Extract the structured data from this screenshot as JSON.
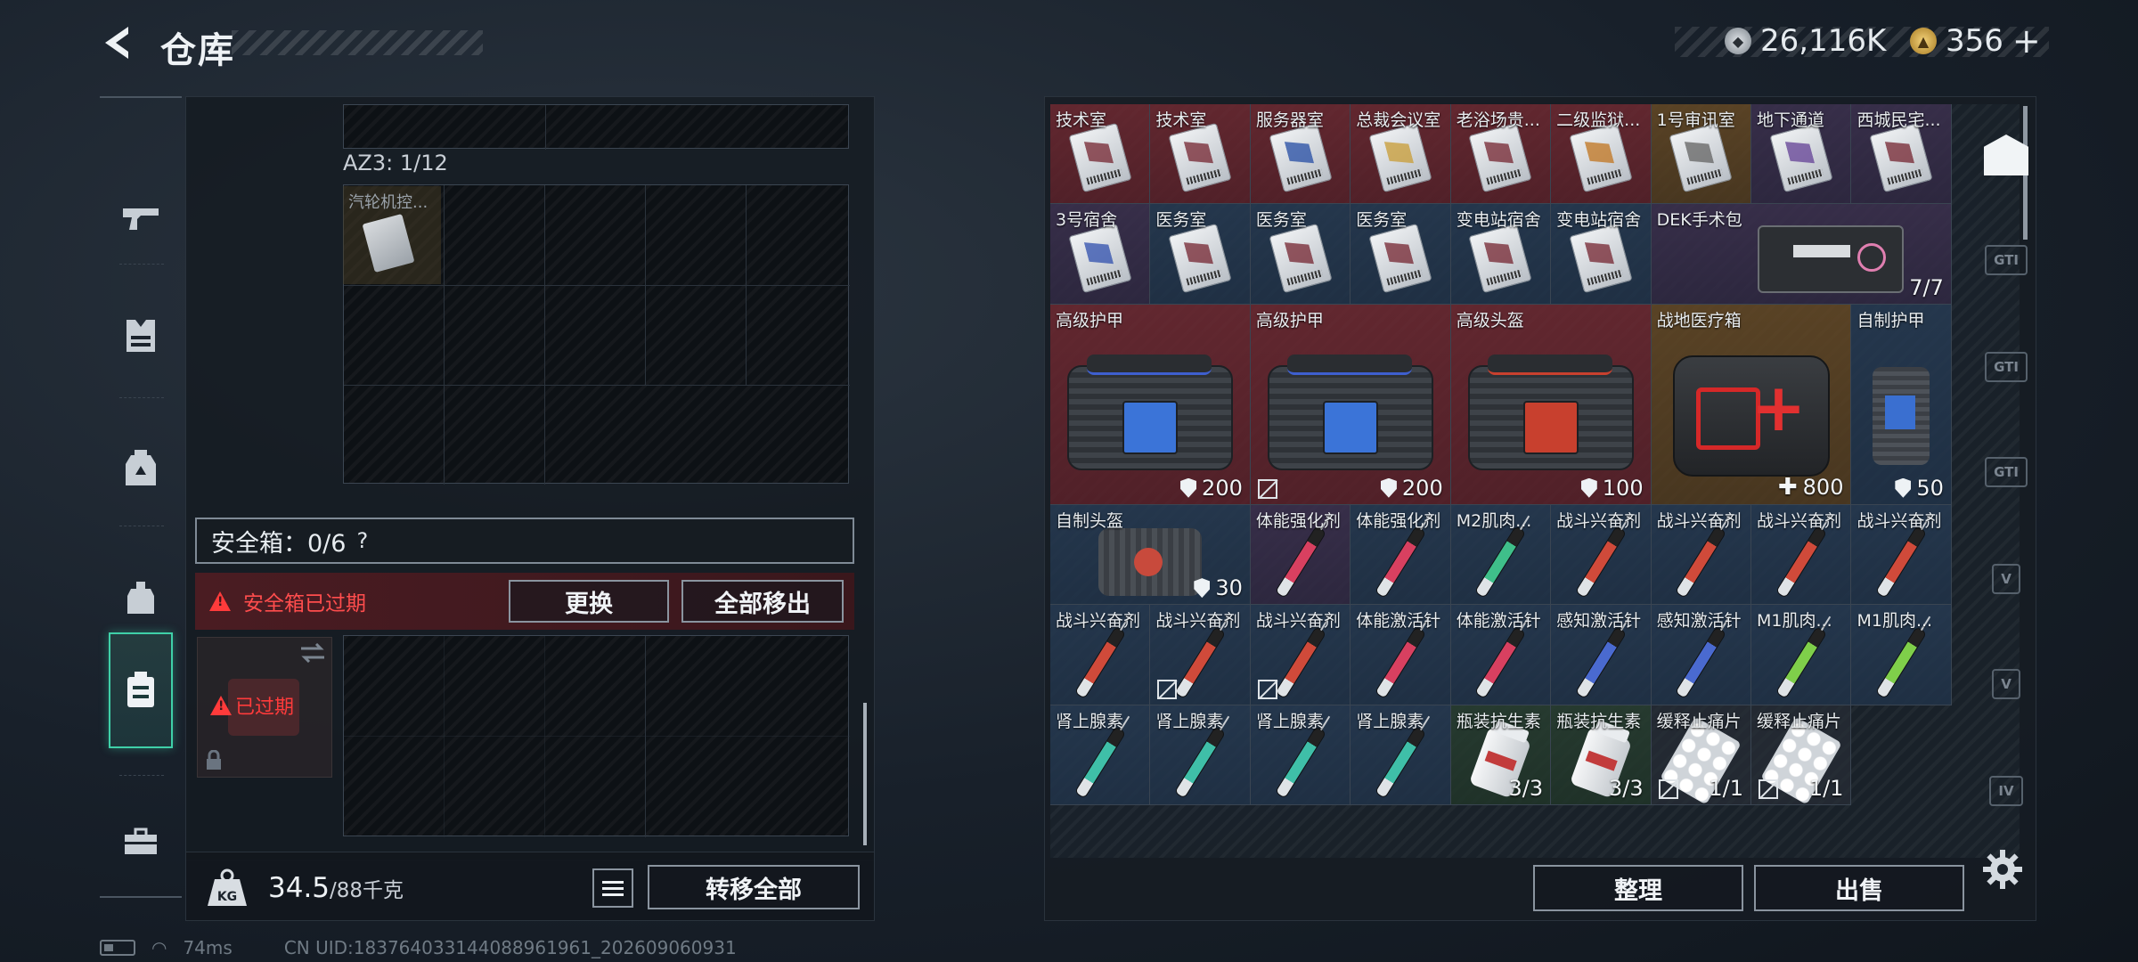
{
  "header": {
    "title": "仓库",
    "currency_silver": "26,116K",
    "currency_gold": "356",
    "currency_gold_add": "+"
  },
  "left_nav": [
    "weapon-icon",
    "vest-icon",
    "backpack-icon",
    "rig-icon",
    "safebox-icon",
    "toolbox-icon"
  ],
  "container": {
    "az3_label": "AZ3: 1/12",
    "item_name": "汽轮机控..."
  },
  "safebox": {
    "label": "安全箱：0/6",
    "help": "?",
    "expired_notice": "安全箱已过期",
    "replace_button": "更换",
    "move_all_button": "全部移出",
    "card_status": "已过期"
  },
  "weight": {
    "current": "34.5",
    "max": "/88千克",
    "transfer_all_button": "转移全部"
  },
  "status": {
    "ping": "74ms",
    "uid": "CN UID:1837640331440889619​61_202609060931"
  },
  "stash": {
    "items": [
      {
        "name": "技术室",
        "rarity": "red",
        "art": "card",
        "accent": "#7a2f3b"
      },
      {
        "name": "技术室",
        "rarity": "red",
        "art": "card",
        "accent": "#7a2f3b"
      },
      {
        "name": "服务器室",
        "rarity": "red",
        "art": "card",
        "accent": "#2f55a8"
      },
      {
        "name": "总裁会议室",
        "rarity": "red",
        "art": "card",
        "accent": "#c9a040"
      },
      {
        "name": "老浴场贵...",
        "rarity": "red",
        "art": "card",
        "accent": "#7a2f3b"
      },
      {
        "name": "二级监狱...",
        "rarity": "red",
        "art": "card",
        "accent": "#c27a2a"
      },
      {
        "name": "1号审讯室",
        "rarity": "gold",
        "art": "card",
        "accent": "#6a6a6a"
      },
      {
        "name": "地下通道",
        "rarity": "purple",
        "art": "card",
        "accent": "#6a4a9a"
      },
      {
        "name": "西城民宅...",
        "rarity": "purple",
        "art": "card",
        "accent": "#7a2f3b"
      },
      {
        "name": "3号宿舍",
        "rarity": "purple",
        "art": "card",
        "accent": "#3a58b0"
      },
      {
        "name": "医务室",
        "rarity": "blue",
        "art": "card",
        "accent": "#7a2f3b"
      },
      {
        "name": "医务室",
        "rarity": "blue",
        "art": "card",
        "accent": "#7a2f3b"
      },
      {
        "name": "医务室",
        "rarity": "blue",
        "art": "card",
        "accent": "#7a2f3b"
      },
      {
        "name": "变电站宿舍",
        "rarity": "blue",
        "art": "card",
        "accent": "#7a2f3b"
      },
      {
        "name": "变电站宿舍",
        "rarity": "blue",
        "art": "card",
        "accent": "#7a2f3b"
      },
      {
        "name": "DEK手术包",
        "rarity": "purple",
        "art": "kit",
        "qty": "7/7"
      },
      {
        "name": "高级护甲",
        "rarity": "red",
        "art": "bag-blue",
        "qty": "200",
        "badge": "shield"
      },
      {
        "name": "高级护甲",
        "rarity": "red",
        "art": "bag-blue",
        "qty": "200",
        "badge": "shield",
        "locked": true
      },
      {
        "name": "高级头盔",
        "rarity": "red",
        "art": "bag-red",
        "qty": "100",
        "badge": "shield"
      },
      {
        "name": "战地医疗箱",
        "rarity": "gold",
        "art": "aidbox",
        "qty": "800",
        "badge": "plus"
      },
      {
        "name": "自制护甲",
        "rarity": "blue",
        "art": "pack",
        "qty": "50",
        "badge": "shield"
      },
      {
        "name": "自制头盔",
        "rarity": "blue",
        "art": "helmet",
        "qty": "30",
        "badge": "shield"
      },
      {
        "name": "体能强化剂",
        "rarity": "purple",
        "art": "syringe",
        "liquid": "#d84060"
      },
      {
        "name": "体能强化剂",
        "rarity": "blue",
        "art": "syringe",
        "liquid": "#d84060"
      },
      {
        "name": "M2肌肉...",
        "rarity": "blue",
        "art": "syringe",
        "liquid": "#3fbf8a"
      },
      {
        "name": "战斗兴奋剂",
        "rarity": "blue",
        "art": "syringe",
        "liquid": "#d04a3a"
      },
      {
        "name": "战斗兴奋剂",
        "rarity": "blue",
        "art": "syringe",
        "liquid": "#d04a3a"
      },
      {
        "name": "战斗兴奋剂",
        "rarity": "blue",
        "art": "syringe",
        "liquid": "#d04a3a"
      },
      {
        "name": "战斗兴奋剂",
        "rarity": "blue",
        "art": "syringe",
        "liquid": "#d04a3a"
      },
      {
        "name": "战斗兴奋剂",
        "rarity": "blue",
        "art": "syringe",
        "liquid": "#d04a3a"
      },
      {
        "name": "战斗兴奋剂",
        "rarity": "blue",
        "art": "syringe",
        "liquid": "#d04a3a",
        "locked": true
      },
      {
        "name": "战斗兴奋剂",
        "rarity": "blue",
        "art": "syringe",
        "liquid": "#d04a3a",
        "locked": true
      },
      {
        "name": "体能激活针",
        "rarity": "blue",
        "art": "syringe",
        "liquid": "#d84060"
      },
      {
        "name": "体能激活针",
        "rarity": "blue",
        "art": "syringe",
        "liquid": "#d84060"
      },
      {
        "name": "感知激活针",
        "rarity": "blue",
        "art": "syringe",
        "liquid": "#4a6ad0"
      },
      {
        "name": "感知激活针",
        "rarity": "blue",
        "art": "syringe",
        "liquid": "#4a6ad0"
      },
      {
        "name": "M1肌肉...",
        "rarity": "blue",
        "art": "syringe",
        "liquid": "#7fcf4a"
      },
      {
        "name": "M1肌肉...",
        "rarity": "blue",
        "art": "syringe",
        "liquid": "#7fcf4a"
      },
      {
        "name": "肾上腺素",
        "rarity": "blue",
        "art": "syringe",
        "liquid": "#3fbfa8"
      },
      {
        "name": "肾上腺素",
        "rarity": "blue",
        "art": "syringe",
        "liquid": "#3fbfa8"
      },
      {
        "name": "肾上腺素",
        "rarity": "blue",
        "art": "syringe",
        "liquid": "#3fbfa8"
      },
      {
        "name": "肾上腺素",
        "rarity": "blue",
        "art": "syringe",
        "liquid": "#3fbfa8"
      },
      {
        "name": "瓶装抗生素",
        "rarity": "green",
        "art": "bottle",
        "qty": "3/3"
      },
      {
        "name": "瓶装抗生素",
        "rarity": "green",
        "art": "bottle",
        "qty": "3/3"
      },
      {
        "name": "缓释止痛片",
        "rarity": "gray",
        "art": "blister",
        "qty": "1/1",
        "locked": true
      },
      {
        "name": "缓释止痛片",
        "rarity": "gray",
        "art": "blister",
        "qty": "1/1",
        "locked": true
      }
    ],
    "sort_button": "整理",
    "sell_button": "出售"
  },
  "right_tabs": [
    {
      "name": "home-icon",
      "label": ""
    },
    {
      "name": "tab-gti",
      "label": "GTI"
    },
    {
      "name": "tab-gti-2",
      "label": "GTI"
    },
    {
      "name": "tab-gti-3",
      "label": "GTI"
    },
    {
      "name": "tab-v",
      "label": "V"
    },
    {
      "name": "tab-v-2",
      "label": "V"
    },
    {
      "name": "tab-iv",
      "label": "IV"
    }
  ],
  "colors": {
    "accent_green": "#3fd0a8",
    "warning_red": "#ff3b3b"
  }
}
